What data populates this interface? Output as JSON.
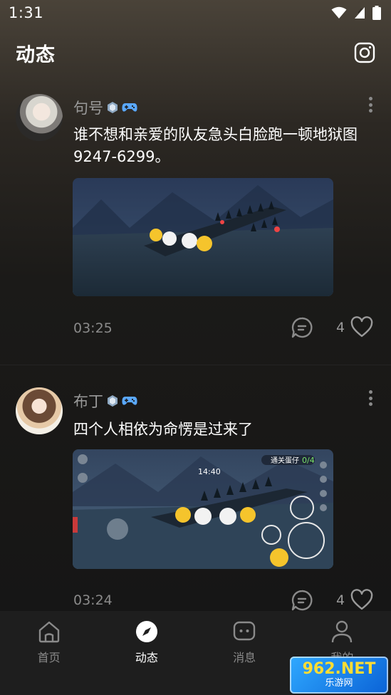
{
  "status_bar": {
    "time": "1:31"
  },
  "header": {
    "title": "动态",
    "camera_icon": "instagram-camera-icon"
  },
  "posts": [
    {
      "username": "句号",
      "text": "谁不想和亲爱的队友急头白脸跑一顿地狱图9247-6299。",
      "time": "03:25",
      "likes": "4"
    },
    {
      "username": "布丁",
      "text": "四个人相依为命愣是过来了",
      "time": "03:24",
      "likes": "4",
      "video_overlay": {
        "timer": "14:40",
        "level_label": "通关蛋仔",
        "progress": "0/4"
      }
    }
  ],
  "nav": {
    "items": [
      {
        "label": "首页",
        "icon": "home-icon"
      },
      {
        "label": "动态",
        "icon": "compass-icon"
      },
      {
        "label": "消息",
        "icon": "chat-icon"
      },
      {
        "label": "我的",
        "icon": "profile-icon"
      }
    ],
    "active": "动态"
  },
  "watermark": {
    "top": "962.NET",
    "bottom": "乐游网"
  },
  "colors": {
    "accent_badge": "#5aa8ff",
    "text_muted": "#8a8a8a",
    "background": "#151515"
  }
}
